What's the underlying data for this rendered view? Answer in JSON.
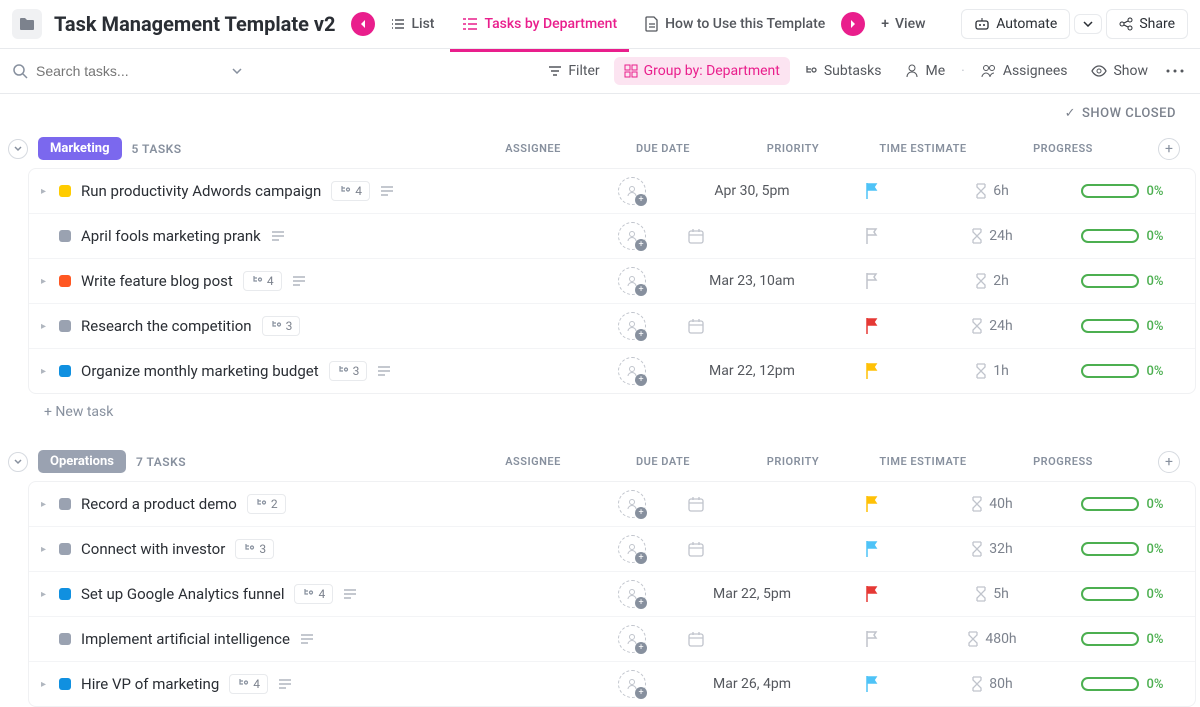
{
  "header": {
    "title": "Task Management Template v2",
    "views": {
      "list": "List",
      "tasksByDept": "Tasks by Department",
      "howTo": "How to Use this Template",
      "addView": "View"
    },
    "automate": "Automate",
    "share": "Share"
  },
  "toolbar": {
    "searchPlaceholder": "Search tasks...",
    "filter": "Filter",
    "groupBy": "Group by: Department",
    "subtasks": "Subtasks",
    "me": "Me",
    "assignees": "Assignees",
    "show": "Show"
  },
  "showClosed": "SHOW CLOSED",
  "columns": {
    "assignee": "ASSIGNEE",
    "dueDate": "DUE DATE",
    "priority": "PRIORITY",
    "timeEstimate": "TIME ESTIMATE",
    "progress": "PROGRESS"
  },
  "newTask": "+ New task",
  "colors": {
    "marketing": "#7b68ee",
    "operations": "#9aa2b1",
    "statusYellow": "#ffcc00",
    "statusGrey": "#9aa2b1",
    "statusOrange": "#ff5722",
    "statusBlue": "#1090e0",
    "flagBlue": "#4fc3f7",
    "flagGrey": "#c0c4cc",
    "flagRed": "#e53935",
    "flagYellow": "#ffc107"
  },
  "groups": [
    {
      "name": "Marketing",
      "badgeColor": "#7b68ee",
      "count": "5 TASKS",
      "tasks": [
        {
          "status": "#ffcc00",
          "name": "Run productivity Adwords campaign",
          "subtasks": "4",
          "desc": true,
          "due": "Apr 30, 5pm",
          "flag": "#4fc3f7",
          "estimate": "6h",
          "progress": "0%",
          "caret": true
        },
        {
          "status": "#9aa2b1",
          "name": "April fools marketing prank",
          "subtasks": "",
          "desc": true,
          "due": "",
          "flag": "#c0c4cc",
          "flagOutline": true,
          "estimate": "24h",
          "progress": "0%",
          "caret": false
        },
        {
          "status": "#ff5722",
          "name": "Write feature blog post",
          "subtasks": "4",
          "desc": true,
          "due": "Mar 23, 10am",
          "flag": "#c0c4cc",
          "flagOutline": true,
          "estimate": "2h",
          "progress": "0%",
          "caret": true
        },
        {
          "status": "#9aa2b1",
          "name": "Research the competition",
          "subtasks": "3",
          "desc": false,
          "due": "",
          "flag": "#e53935",
          "estimate": "24h",
          "progress": "0%",
          "caret": true
        },
        {
          "status": "#1090e0",
          "name": "Organize monthly marketing budget",
          "subtasks": "3",
          "desc": true,
          "due": "Mar 22, 12pm",
          "flag": "#ffc107",
          "estimate": "1h",
          "progress": "0%",
          "caret": true
        }
      ]
    },
    {
      "name": "Operations",
      "badgeColor": "#9aa2b1",
      "count": "7 TASKS",
      "tasks": [
        {
          "status": "#9aa2b1",
          "name": "Record a product demo",
          "subtasks": "2",
          "desc": false,
          "due": "",
          "flag": "#ffc107",
          "estimate": "40h",
          "progress": "0%",
          "caret": true
        },
        {
          "status": "#9aa2b1",
          "name": "Connect with investor",
          "subtasks": "3",
          "desc": false,
          "due": "",
          "flag": "#4fc3f7",
          "estimate": "32h",
          "progress": "0%",
          "caret": true
        },
        {
          "status": "#1090e0",
          "name": "Set up Google Analytics funnel",
          "subtasks": "4",
          "desc": true,
          "due": "Mar 22, 5pm",
          "flag": "#e53935",
          "estimate": "5h",
          "progress": "0%",
          "caret": true
        },
        {
          "status": "#9aa2b1",
          "name": "Implement artificial intelligence",
          "subtasks": "",
          "desc": true,
          "due": "",
          "flag": "#c0c4cc",
          "flagOutline": true,
          "estimate": "480h",
          "progress": "0%",
          "caret": false
        },
        {
          "status": "#1090e0",
          "name": "Hire VP of marketing",
          "subtasks": "4",
          "desc": true,
          "due": "Mar 26, 4pm",
          "flag": "#4fc3f7",
          "estimate": "80h",
          "progress": "0%",
          "caret": true
        }
      ]
    }
  ]
}
